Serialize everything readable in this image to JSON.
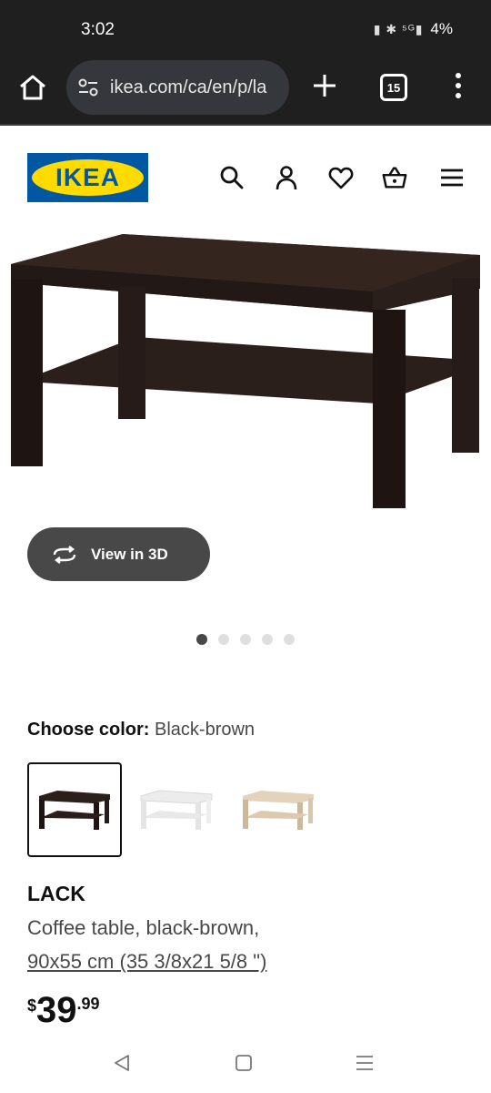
{
  "status_bar": {
    "time": "3:02",
    "icons": "▮ ✱ ⁵ᴳ▮",
    "battery": "4%"
  },
  "browser": {
    "url": "ikea.com/ca/en/p/la",
    "tab_count": "15"
  },
  "header": {
    "logo_text": "IKEA"
  },
  "product": {
    "view3d_label": "View in 3D",
    "image_dots": {
      "count": 5,
      "active": 1
    },
    "choose_color_label": "Choose color:",
    "color_value": "Black-brown",
    "swatches": [
      {
        "name": "Black-brown",
        "selected": true
      },
      {
        "name": "White",
        "selected": false
      },
      {
        "name": "White stained oak effect",
        "selected": false
      }
    ],
    "name": "LACK",
    "description": "Coffee table, black-brown,",
    "size": "90x55 cm (35 3/8x21 5/8 \")",
    "price": {
      "currency": "$",
      "integer": "39",
      "cents": ".99"
    }
  },
  "colors": {
    "ikea_blue": "#0058a3",
    "ikea_yellow": "#ffdb00",
    "table_dark": "#2b1f1c",
    "button_dark": "#484848"
  }
}
